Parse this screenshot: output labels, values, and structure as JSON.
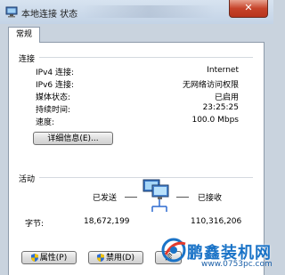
{
  "window": {
    "title": "本地连接 状态",
    "close_glyph": "✕"
  },
  "tabs": [
    {
      "label": "常规"
    }
  ],
  "connection": {
    "heading": "连接",
    "rows": [
      {
        "label": "IPv4 连接:",
        "value": "Internet"
      },
      {
        "label": "IPv6 连接:",
        "value": "无网络访问权限"
      },
      {
        "label": "媒体状态:",
        "value": "已启用"
      },
      {
        "label": "持续时间:",
        "value": "23:25:25"
      },
      {
        "label": "速度:",
        "value": "100.0 Mbps"
      }
    ],
    "details_button": "详细信息(E)..."
  },
  "activity": {
    "heading": "活动",
    "sent_label": "已发送",
    "received_label": "已接收",
    "bytes_label": "字节:",
    "bytes_sent": "18,672,199",
    "bytes_received": "110,316,206"
  },
  "buttons": {
    "properties": "属性(P)",
    "disable": "禁用(D)",
    "diagnose": "诊"
  },
  "watermark": {
    "text": "鹏鑫装机网",
    "url": "www.0753pc.com"
  }
}
